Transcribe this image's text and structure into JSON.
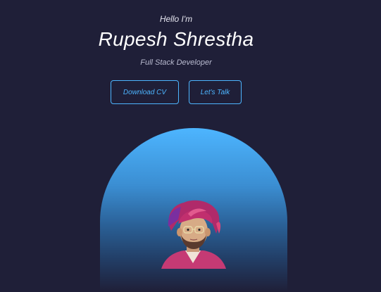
{
  "header": {
    "greeting": "Hello I'm",
    "name": "Rupesh Shrestha",
    "role": "Full Stack Developer"
  },
  "cta": {
    "download_label": "Download CV",
    "talk_label": "Let's Talk"
  },
  "colors": {
    "background": "#1f1f38",
    "accent": "#4db5ff",
    "text": "#ffffff",
    "muted": "#b9bbd0"
  }
}
